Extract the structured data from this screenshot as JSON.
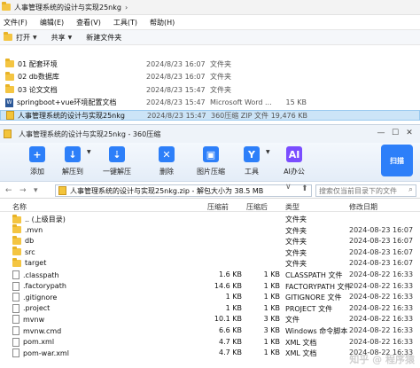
{
  "explorer": {
    "breadcrumb": [
      "人事管理系统的设计与实现25nkg"
    ],
    "menu": [
      "文件(F)",
      "编辑(E)",
      "查看(V)",
      "工具(T)",
      "帮助(H)"
    ],
    "toolbar": {
      "open": "打开",
      "share": "共享",
      "new_folder": "新建文件夹"
    },
    "rows": [
      {
        "name": "01 配套环境",
        "date": "2024/8/23 16:07",
        "type": "文件夹",
        "size": "",
        "icon": "folder-icon"
      },
      {
        "name": "02 db数据库",
        "date": "2024/8/23 16:07",
        "type": "文件夹",
        "size": "",
        "icon": "folder-icon"
      },
      {
        "name": "03 论文文档",
        "date": "2024/8/23 15:47",
        "type": "文件夹",
        "size": "",
        "icon": "folder-icon"
      },
      {
        "name": "springboot+vue环境配置文档",
        "date": "2024/8/23 15:47",
        "type": "Microsoft Word ...",
        "size": "15 KB",
        "icon": "word-icon"
      },
      {
        "name": "人事管理系统的设计与实现25nkg",
        "date": "2024/8/23 15:47",
        "type": "360压缩 ZIP 文件",
        "size": "19,476 KB",
        "icon": "zip-icon",
        "selected": true
      }
    ]
  },
  "zip": {
    "title": "人事管理系统的设计与实现25nkg - 360压缩",
    "toolbar": [
      {
        "label": "添加",
        "icon": "add-icon",
        "color": "#2d7ff9",
        "glyph": "+"
      },
      {
        "label": "解压到",
        "icon": "extract-to-icon",
        "color": "#2d7ff9",
        "glyph": "↓"
      },
      {
        "label": "一键解压",
        "icon": "one-click-extract-icon",
        "color": "#2d7ff9",
        "glyph": "⇣"
      },
      {
        "label": "删除",
        "icon": "delete-icon",
        "color": "#2d7ff9",
        "glyph": "✕"
      },
      {
        "label": "图片压缩",
        "icon": "image-compress-icon",
        "color": "#2d7ff9",
        "glyph": "▣"
      },
      {
        "label": "工具",
        "icon": "tools-icon",
        "color": "#2d7ff9",
        "glyph": "Y"
      },
      {
        "label": "AI办公",
        "icon": "ai-office-icon",
        "color": "#7a4dff",
        "glyph": "AI"
      }
    ],
    "scan_label": "扫描",
    "address": "人事管理系统的设计与实现25nkg.zip - 解包大小为 38.5 MB",
    "search_placeholder": "搜索仅当前目录下的文件",
    "columns": [
      "名称",
      "压缩前",
      "压缩后",
      "类型",
      "修改日期"
    ],
    "rows": [
      {
        "name": ".. (上级目录)",
        "before": "",
        "after": "",
        "type": "文件夹",
        "date": "",
        "icon": "folder-icon"
      },
      {
        "name": ".mvn",
        "before": "",
        "after": "",
        "type": "文件夹",
        "date": "2024-08-23 16:07",
        "icon": "folder-icon"
      },
      {
        "name": "db",
        "before": "",
        "after": "",
        "type": "文件夹",
        "date": "2024-08-23 16:07",
        "icon": "folder-icon"
      },
      {
        "name": "src",
        "before": "",
        "after": "",
        "type": "文件夹",
        "date": "2024-08-23 16:07",
        "icon": "folder-icon"
      },
      {
        "name": "target",
        "before": "",
        "after": "",
        "type": "文件夹",
        "date": "2024-08-23 16:07",
        "icon": "folder-icon"
      },
      {
        "name": ".classpath",
        "before": "1.6 KB",
        "after": "1 KB",
        "type": "CLASSPATH 文件",
        "date": "2024-08-22 16:33",
        "icon": "file-icon"
      },
      {
        "name": ".factorypath",
        "before": "14.6 KB",
        "after": "1 KB",
        "type": "FACTORYPATH 文件",
        "date": "2024-08-22 16:33",
        "icon": "file-icon"
      },
      {
        "name": ".gitignore",
        "before": "1 KB",
        "after": "1 KB",
        "type": "GITIGNORE 文件",
        "date": "2024-08-22 16:33",
        "icon": "file-icon"
      },
      {
        "name": ".project",
        "before": "1 KB",
        "after": "1 KB",
        "type": "PROJECT 文件",
        "date": "2024-08-22 16:33",
        "icon": "file-icon"
      },
      {
        "name": "mvnw",
        "before": "10.1 KB",
        "after": "3 KB",
        "type": "文件",
        "date": "2024-08-22 16:33",
        "icon": "file-icon"
      },
      {
        "name": "mvnw.cmd",
        "before": "6.6 KB",
        "after": "3 KB",
        "type": "Windows 命令脚本",
        "date": "2024-08-22 16:33",
        "icon": "file-icon"
      },
      {
        "name": "pom.xml",
        "before": "4.7 KB",
        "after": "1 KB",
        "type": "XML 文档",
        "date": "2024-08-22 16:33",
        "icon": "file-icon"
      },
      {
        "name": "pom-war.xml",
        "before": "4.7 KB",
        "after": "1 KB",
        "type": "XML 文档",
        "date": "2024-08-22 16:33",
        "icon": "file-icon"
      }
    ],
    "watermark": "知乎 @ 程序猿"
  }
}
